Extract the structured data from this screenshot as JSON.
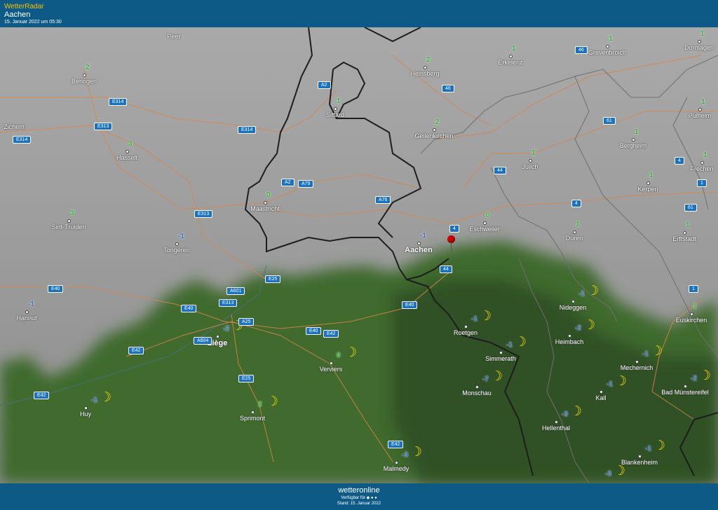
{
  "header": {
    "app_name": "WetterRadar",
    "location": "Aachen",
    "timestamp": "15. Januar 2022 um 05:30"
  },
  "footer": {
    "brand": "wetteronline",
    "available": "Verfügbar für",
    "stand": "Stand: 15. Januar 2022"
  },
  "colors": {
    "header_bg": "#0e5a87",
    "accent": "#f5c400",
    "temp_positive": "#2fb52f",
    "temp_negative": "#3a6fd0",
    "moon": "#f2d400"
  },
  "map": {
    "cities": [
      {
        "name": "Peer",
        "label": "Peer",
        "temp": ""
      },
      {
        "name": "Beringen",
        "label": "Beringen",
        "temp": "2"
      },
      {
        "name": "Zichem",
        "label": "Zichem",
        "temp": ""
      },
      {
        "name": "Hasselt",
        "label": "Hasselt",
        "temp": "3"
      },
      {
        "name": "Sint-Truiden",
        "label": "Sint-Truiden",
        "temp": "3"
      },
      {
        "name": "Tongeren",
        "label": "Tongeren",
        "temp": "-1"
      },
      {
        "name": "Hannut",
        "label": "Hannut",
        "temp": "-1"
      },
      {
        "name": "Maastricht",
        "label": "Maastricht",
        "temp": "0"
      },
      {
        "name": "Sittard",
        "label": "Sittard",
        "temp": "1"
      },
      {
        "name": "Heinsberg",
        "label": "Heinsberg",
        "temp": "2"
      },
      {
        "name": "Erkelenz",
        "label": "Erkelenz",
        "temp": "1"
      },
      {
        "name": "Grevenbroich",
        "label": "Grevenbroich",
        "temp": "1"
      },
      {
        "name": "Dormagen",
        "label": "Dormagen",
        "temp": "1"
      },
      {
        "name": "Geilenkirchen",
        "label": "Geilenkirchen",
        "temp": "2"
      },
      {
        "name": "Pulheim",
        "label": "Pulheim",
        "temp": "1"
      },
      {
        "name": "Bergheim",
        "label": "Bergheim",
        "temp": "1"
      },
      {
        "name": "Julich",
        "label": "Julich",
        "temp": "1"
      },
      {
        "name": "Frechen",
        "label": "Frechen",
        "temp": "1"
      },
      {
        "name": "Kerpen",
        "label": "Kerpen",
        "temp": "1"
      },
      {
        "name": "Eschweiler",
        "label": "Eschweiler",
        "temp": "0"
      },
      {
        "name": "Aachen",
        "label": "Aachen",
        "temp": "-1"
      },
      {
        "name": "Duren",
        "label": "Düren",
        "temp": "1"
      },
      {
        "name": "Erftstadt",
        "label": "Erftstadt",
        "temp": "1"
      },
      {
        "name": "Euskirchen",
        "label": "Euskirchen",
        "temp": "1"
      },
      {
        "name": "Nideggen",
        "label": "Nideggen",
        "temp": "-1"
      },
      {
        "name": "Heimbach",
        "label": "Heimbach",
        "temp": "-2"
      },
      {
        "name": "Roetgen",
        "label": "Roetgen",
        "temp": "-1"
      },
      {
        "name": "Simmerath",
        "label": "Simmerath",
        "temp": "-1"
      },
      {
        "name": "Monschau",
        "label": "Monschau",
        "temp": "-7"
      },
      {
        "name": "Mechernich",
        "label": "Mechernich",
        "temp": "-1"
      },
      {
        "name": "Bad Munstereifel",
        "label": "Bad Münstereifel",
        "temp": "-2"
      },
      {
        "name": "Kall",
        "label": "Kall",
        "temp": "-1"
      },
      {
        "name": "Hellenthal",
        "label": "Hellenthal",
        "temp": "-3"
      },
      {
        "name": "Blankenheim",
        "label": "Blankenheim",
        "temp": "-1"
      },
      {
        "name": "Liege",
        "label": "Liège",
        "temp": "-2"
      },
      {
        "name": "Verviers",
        "label": "Verviers",
        "temp": "0"
      },
      {
        "name": "Huy",
        "label": "Huy",
        "temp": "-1"
      },
      {
        "name": "Sprimont",
        "label": "Sprimont",
        "temp": "2"
      },
      {
        "name": "Malmedy",
        "label": "Malmedy",
        "temp": "-3"
      },
      {
        "name": "unnamed-se",
        "label": "",
        "temp": "-3"
      }
    ],
    "road_shields": [
      "E314",
      "E313",
      "E314",
      "E314",
      "E313",
      "A2",
      "A2",
      "A79",
      "A76",
      "46",
      "46",
      "61",
      "44",
      "4",
      "4",
      "61",
      "1",
      "1",
      "E40",
      "E40",
      "A601",
      "E313",
      "E25",
      "A25",
      "E40",
      "E40",
      "E42",
      "A604",
      "E42",
      "E42",
      "E25",
      "E42",
      "44",
      "4"
    ]
  }
}
